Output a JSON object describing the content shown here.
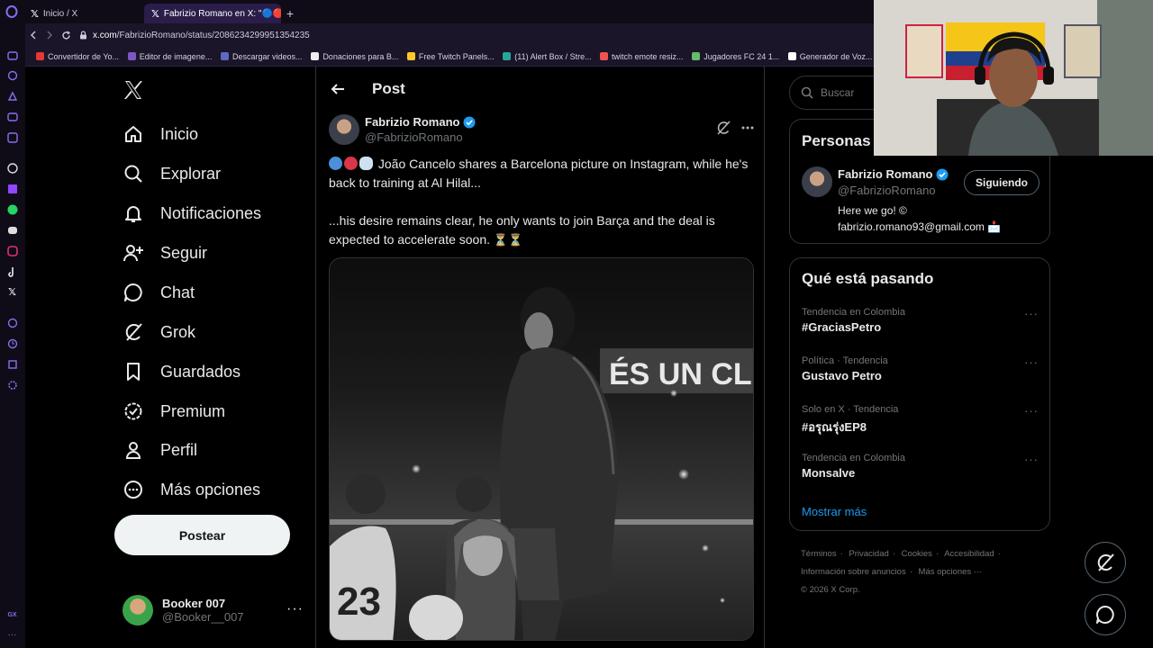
{
  "browser": {
    "tabs": [
      {
        "label": "Inicio / X",
        "active": false
      },
      {
        "label": "Fabrizio Romano en X: \"🔵🔴",
        "active": true
      }
    ],
    "url": {
      "host": "x.com",
      "path": "/FabrizioRomano/status/2086234299951354235"
    },
    "bookmarks": [
      {
        "label": "Convertidor de Yo...",
        "color": "#e53935"
      },
      {
        "label": "Editor de imagene...",
        "color": "#7e57c2"
      },
      {
        "label": "Descargar videos...",
        "color": "#5c6bc0"
      },
      {
        "label": "Donaciones para B...",
        "color": "#eeeeee"
      },
      {
        "label": "Free Twitch Panels...",
        "color": "#ffca28"
      },
      {
        "label": "(11) Alert Box / Stre...",
        "color": "#26a69a"
      },
      {
        "label": "twitch emote resiz...",
        "color": "#ef5350"
      },
      {
        "label": "Jugadores FC 24 1...",
        "color": "#66bb6a"
      },
      {
        "label": "Generador de Voz...",
        "color": "#ffffff"
      }
    ]
  },
  "nav": {
    "items": [
      {
        "label": "Inicio",
        "icon": "home-icon"
      },
      {
        "label": "Explorar",
        "icon": "search-icon"
      },
      {
        "label": "Notificaciones",
        "icon": "bell-icon"
      },
      {
        "label": "Seguir",
        "icon": "add-person-icon"
      },
      {
        "label": "Chat",
        "icon": "chat-icon"
      },
      {
        "label": "Grok",
        "icon": "grok-icon"
      },
      {
        "label": "Guardados",
        "icon": "bookmark-icon"
      },
      {
        "label": "Premium",
        "icon": "premium-icon"
      },
      {
        "label": "Perfil",
        "icon": "person-icon"
      },
      {
        "label": "Más opciones",
        "icon": "more-circle-icon"
      }
    ],
    "post_button": "Postear",
    "account": {
      "name": "Booker 007",
      "handle": "@Booker__007",
      "more": "···"
    }
  },
  "post": {
    "header": "Post",
    "author": {
      "name": "Fabrizio Romano",
      "handle": "@FabrizioRomano"
    },
    "text_line1": "João Cancelo shares a Barcelona picture on Instagram, while he's back to training at Al Hilal...",
    "text_line2": "...his desire remains clear, he only wants to join Barça and the deal is expected to accelerate soon.",
    "image_banner_text": "ÉS UN CL",
    "jersey_number": "23"
  },
  "right": {
    "search_placeholder": "Buscar",
    "who_to_follow": {
      "title": "Personas r",
      "name": "Fabrizio Romano",
      "handle": "@FabrizioRomano",
      "bio": "Here we go! © fabrizio.romano93@gmail.com 📩",
      "button": "Siguiendo"
    },
    "trends": {
      "title": "Qué está pasando",
      "items": [
        {
          "meta": "Tendencia en Colombia",
          "name": "#GraciasPetro"
        },
        {
          "meta": "Política · Tendencia",
          "name": "Gustavo Petro"
        },
        {
          "meta": "Solo en X · Tendencia",
          "name": "#อรุณรุ่งEP8"
        },
        {
          "meta": "Tendencia en Colombia",
          "name": "Monsalve"
        }
      ],
      "more": "···",
      "show_more": "Mostrar más"
    },
    "footer": {
      "links": [
        "Términos",
        "Privacidad",
        "Cookies",
        "Accesibilidad",
        "Información sobre anuncios",
        "Más opciones ···"
      ],
      "copyright": "© 2026 X Corp."
    }
  },
  "colors": {
    "accent": "#1d9bf0",
    "background": "#000000",
    "border": "#2f3336",
    "muted": "#71767b",
    "browser_chrome": "#1a1528"
  }
}
